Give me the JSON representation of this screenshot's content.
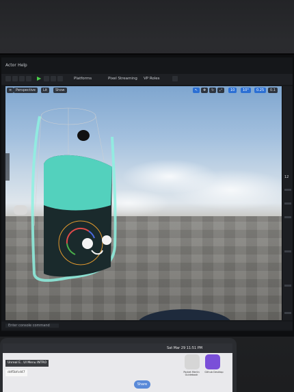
{
  "menu": {
    "actor": "Actor",
    "help": "Help"
  },
  "toolbar": {
    "platforms": "Platforms",
    "pixel_streaming": "Pixel Streaming",
    "vp_roles": "VP Roles"
  },
  "viewport": {
    "perspective": "Perspective",
    "lit": "Lit",
    "show": "Show",
    "grid_snap": "10",
    "rotation_snap": "10°",
    "scale_snap": "0.25",
    "camera_speed": "0.1"
  },
  "right_panel": {
    "number": "12"
  },
  "statusbar": {
    "text": "Enter console command"
  },
  "laptop": {
    "clock": "Sat Mar 29  11:51 PM",
    "tab_1": "Unreal E.. UI Menu INTRO",
    "tab_2": "ddf5bfcd47",
    "share": "Share",
    "app_1": "Pocket Merlin Guidebook",
    "app_2": "Github Desktop"
  },
  "colors": {
    "accent": "#2b6fd4",
    "character_teal": "#66e0cc",
    "sky": "#a3c0de"
  }
}
